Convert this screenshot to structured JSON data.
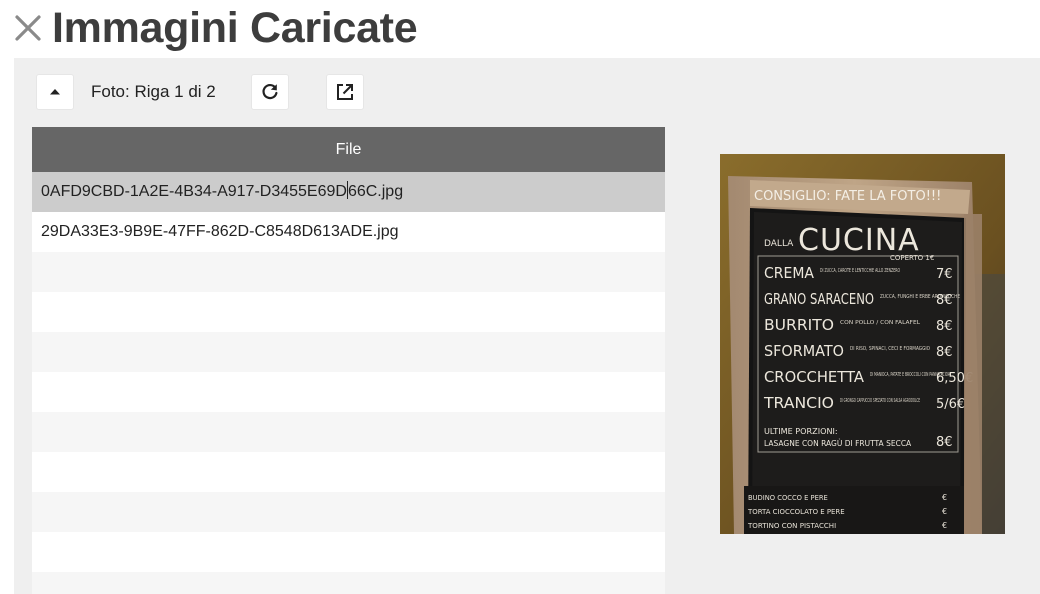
{
  "header": {
    "title": "Immagini Caricate",
    "close_icon": "close-icon"
  },
  "toolbar": {
    "up_icon": "triangle-up-icon",
    "row_info": "Foto: Riga 1 di 2",
    "refresh_icon": "refresh-icon",
    "open_icon": "open-external-icon"
  },
  "grid": {
    "column_header": "File",
    "rows": [
      {
        "file_before_caret": "0AFD9CBD-1A2E-4B34-A917-D3455E69D",
        "file_after_caret": "66C.jpg",
        "selected": true
      },
      {
        "file": "29DA33E3-9B9E-47FF-862D-C8548D613ADE.jpg",
        "selected": false
      }
    ]
  },
  "preview": {
    "image_semantic": "chalkboard-menu-photo",
    "board_header": "CONSIGLIO: FATE LA FOTO!!!",
    "board_title_small": "DALLA",
    "board_title": "CUCINA",
    "board_coperto": "COPERTO 1€",
    "menu_items": [
      {
        "name": "CREMA",
        "desc": "DI ZUCCA, CAROTE E LENTICCHIE ALLO ZENZERO",
        "price": "7€"
      },
      {
        "name": "GRANO SARACENO",
        "desc": "ZUCCA, FUNGHI E ERBE AROMATICHE",
        "price": "8€"
      },
      {
        "name": "BURRITO",
        "desc": "CON POLLO / CON FALAFEL",
        "price": "8€"
      },
      {
        "name": "SFORMATO",
        "desc": "DI RISO, SPINACI, CECI E FORMAGGIO",
        "price": "8€"
      },
      {
        "name": "CROCCHETTA",
        "desc": "DI MANIOCA, PATATE E BROCCOLI CON PANNA ACIDA",
        "price": "6,50€"
      },
      {
        "name": "TRANCIO",
        "desc": "DI GRONGO CAPPUCCIO SPEZIATO CON SALSA AGRODOLCE",
        "price": "5/6€"
      },
      {
        "name": "ULTIME PORZIONI:",
        "desc": "",
        "price": ""
      },
      {
        "name": "LASAGNE CON RAGÙ DI FRUTTA SECCA",
        "desc": "",
        "price": "8€"
      }
    ],
    "dessert_items": [
      {
        "name": "BUDINO COCCO E PERE",
        "price": "€"
      },
      {
        "name": "TORTA CIOCCOLATO E PERE",
        "price": "€"
      },
      {
        "name": "TORTINO CON PISTACCHI",
        "price": "€"
      }
    ]
  }
}
